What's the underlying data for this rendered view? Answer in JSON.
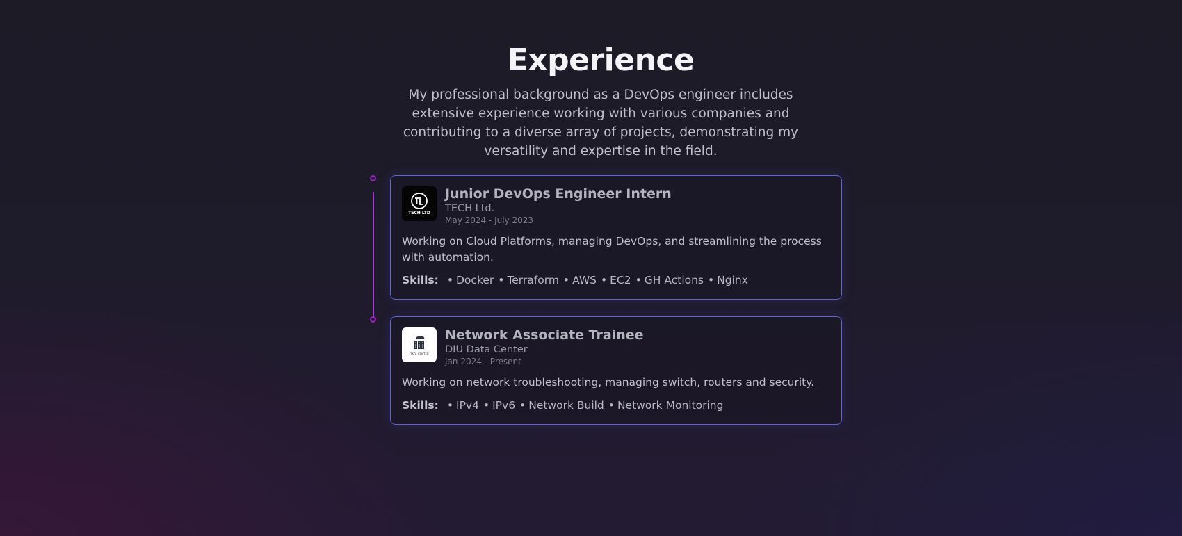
{
  "section": {
    "title": "Experience",
    "intro": "My professional background as a DevOps engineer includes extensive experience working with various companies and contributing to a diverse array of projects, demonstrating my versatility and expertise in the field."
  },
  "experiences": [
    {
      "logo_text": "TECH LTD",
      "logo_icon": "tl-monogram-icon",
      "title": "Junior DevOps Engineer Intern",
      "company": "TECH Ltd.",
      "dates": "May 2024 - July 2023",
      "description": "Working on Cloud Platforms, managing DevOps, and streamlining the process with automation.",
      "skills_label": "Skills:",
      "skills": [
        "Docker",
        "Terraform",
        "AWS",
        "EC2",
        "GH Actions",
        "Nginx"
      ]
    },
    {
      "logo_text": "DATA CENTER",
      "logo_icon": "data-center-icon",
      "title": "Network Associate Trainee",
      "company": "DIU Data Center",
      "dates": "Jan 2024 - Present",
      "description": "Working on network troubleshooting, managing switch, routers and security.",
      "skills_label": "Skills:",
      "skills": [
        "IPv4",
        "IPv6",
        "Network Build",
        "Network Monitoring"
      ]
    }
  ],
  "colors": {
    "accent_border": "#5b63e6",
    "timeline": "#a438d8"
  }
}
